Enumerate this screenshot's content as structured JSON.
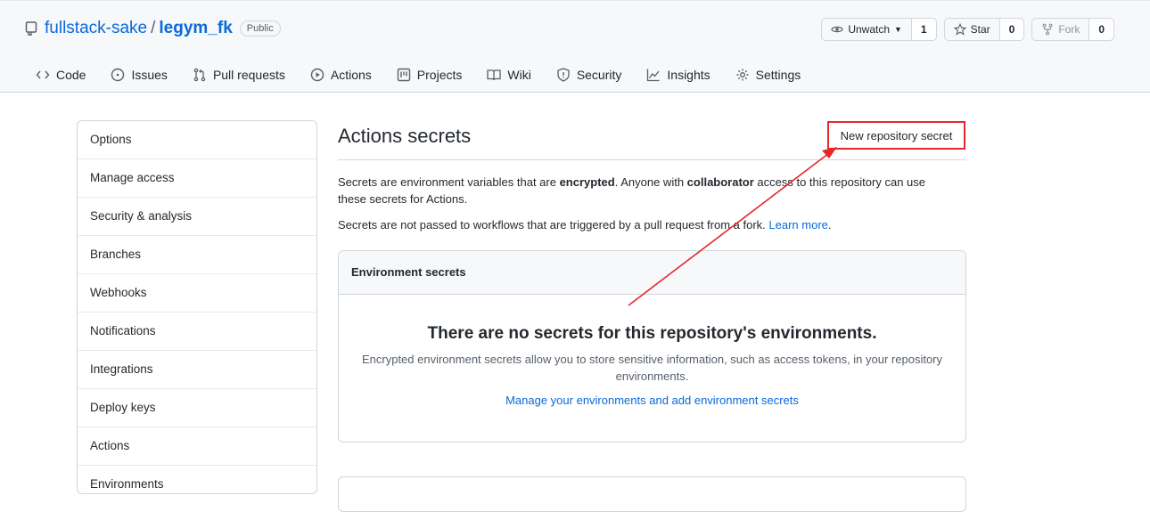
{
  "repo": {
    "owner": "fullstack-sake",
    "separator": "/",
    "name": "legym_fk",
    "visibility": "Public"
  },
  "header_buttons": {
    "unwatch": {
      "label": "Unwatch",
      "count": "1"
    },
    "star": {
      "label": "Star",
      "count": "0"
    },
    "fork": {
      "label": "Fork",
      "count": "0"
    }
  },
  "nav": {
    "code": "Code",
    "issues": "Issues",
    "pulls": "Pull requests",
    "actions": "Actions",
    "projects": "Projects",
    "wiki": "Wiki",
    "security": "Security",
    "insights": "Insights",
    "settings": "Settings"
  },
  "sidebar": {
    "items": [
      "Options",
      "Manage access",
      "Security & analysis",
      "Branches",
      "Webhooks",
      "Notifications",
      "Integrations",
      "Deploy keys",
      "Actions",
      "Environments"
    ]
  },
  "main": {
    "title": "Actions secrets",
    "new_secret_button": "New repository secret",
    "desc1_a": "Secrets are environment variables that are ",
    "desc1_b": "encrypted",
    "desc1_c": ". Anyone with ",
    "desc1_d": "collaborator",
    "desc1_e": " access to this repository can use these secrets for Actions.",
    "desc2_a": "Secrets are not passed to workflows that are triggered by a pull request from a fork. ",
    "desc2_link": "Learn more",
    "desc2_end": ".",
    "env_header": "Environment secrets",
    "env_empty_title": "There are no secrets for this repository's environments.",
    "env_empty_desc": "Encrypted environment secrets allow you to store sensitive information, such as access tokens, in your repository environments.",
    "env_empty_link": "Manage your environments and add environment secrets"
  },
  "colors": {
    "accent": "#0969da",
    "annotation": "#e5262b"
  }
}
